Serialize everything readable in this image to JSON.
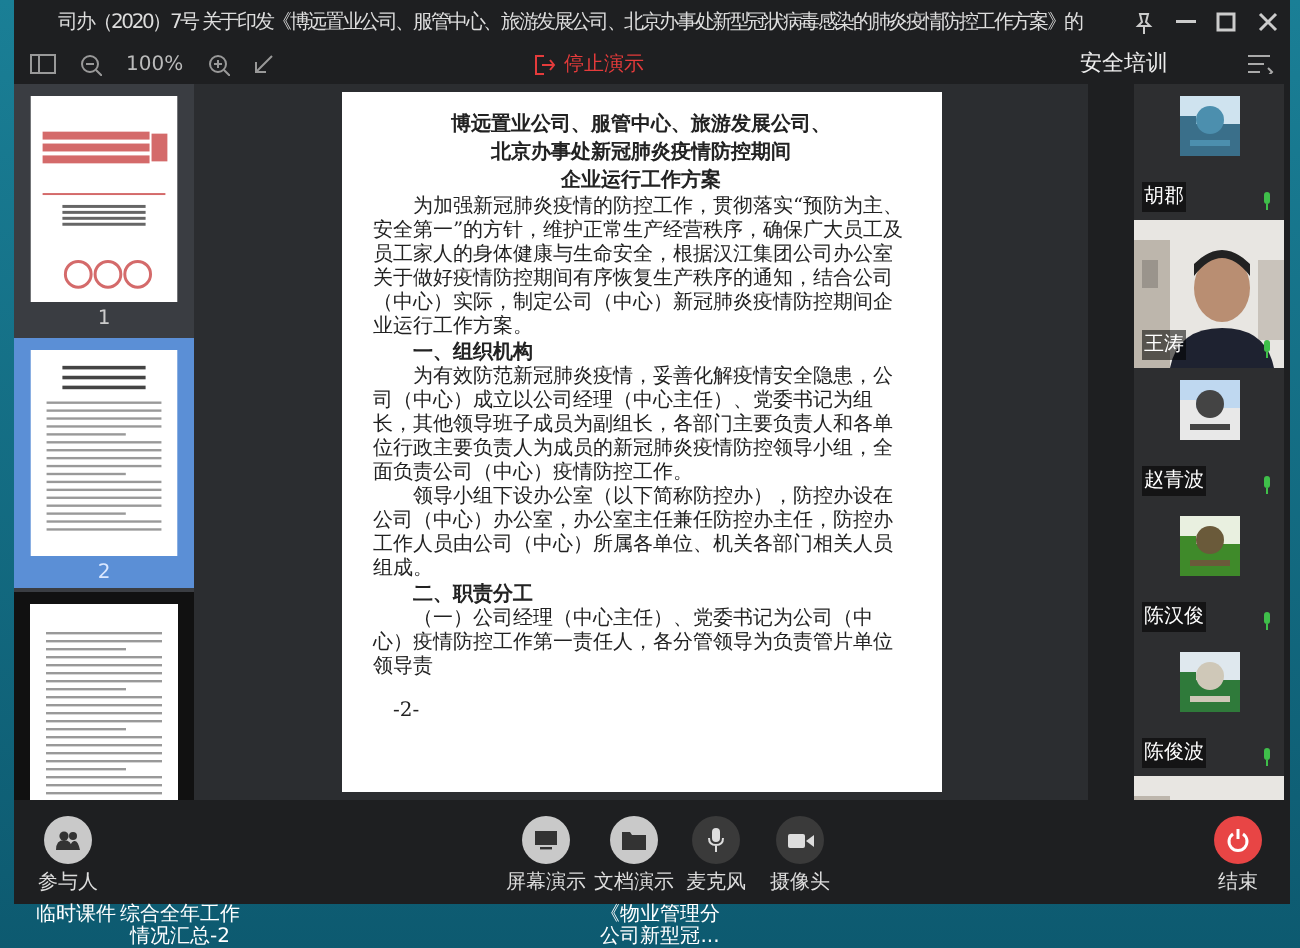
{
  "window": {
    "title": "司办（2020）7号 关于印发《博远置业公司、服管中心、旅游发展公司、北京办事处新型冠状病毒感染的肺炎疫情防控工作方案》的"
  },
  "toolbar": {
    "zoom": "100%",
    "stop_button": "停止演示",
    "meeting_name": "安全培训"
  },
  "thumbnails": [
    {
      "page": "1",
      "kind": "redhead",
      "selected": false
    },
    {
      "page": "2",
      "kind": "text",
      "selected": true
    },
    {
      "kind": "text",
      "selected": false
    }
  ],
  "document": {
    "titles": [
      "博远置业公司、服管中心、旅游发展公司、",
      "北京办事处新冠肺炎疫情防控期间",
      "企业运行工作方案"
    ],
    "blocks": [
      {
        "kind": "paragraph",
        "text": "为加强新冠肺炎疫情的防控工作，贯彻落实“预防为主、安全第一”的方针，维护正常生产经营秩序，确保广大员工及员工家人的身体健康与生命安全，根据汉江集团公司办公室关于做好疫情防控期间有序恢复生产秩序的通知，结合公司（中心）实际，制定公司（中心）新冠肺炎疫情防控期间企业运行工作方案。"
      },
      {
        "kind": "heading",
        "text": "一、组织机构"
      },
      {
        "kind": "paragraph",
        "text": "为有效防范新冠肺炎疫情，妥善化解疫情安全隐患，公司（中心）成立以公司经理（中心主任）、党委书记为组长，其他领导班子成员为副组长，各部门主要负责人和各单位行政主要负责人为成员的新冠肺炎疫情防控领导小组，全面负责公司（中心）疫情防控工作。"
      },
      {
        "kind": "paragraph",
        "text": "领导小组下设办公室（以下简称防控办），防控办设在公司（中心）办公室，办公室主任兼任防控办主任，防控办工作人员由公司（中心）所属各单位、机关各部门相关人员组成。"
      },
      {
        "kind": "heading",
        "text": "二、职责分工"
      },
      {
        "kind": "paragraph",
        "text": "（一）公司经理（中心主任）、党委书记为公司（中心）疫情防控工作第一责任人，各分管领导为负责管片单位领导责"
      }
    ],
    "page_number": "-2-"
  },
  "participants": [
    {
      "name": "胡郡",
      "kind": "avatar"
    },
    {
      "name": "王涛",
      "kind": "video"
    },
    {
      "name": "赵青波",
      "kind": "avatar"
    },
    {
      "name": "陈汉俊",
      "kind": "avatar"
    },
    {
      "name": "陈俊波",
      "kind": "avatar"
    },
    {
      "kind": "video"
    }
  ],
  "controls": [
    {
      "label": "参与人",
      "kind": "people"
    },
    {
      "label": "屏幕演示",
      "kind": "screen"
    },
    {
      "label": "文档演示",
      "kind": "folder"
    },
    {
      "label": "麦克风",
      "kind": "mic"
    },
    {
      "label": "摄像头",
      "kind": "camera"
    },
    {
      "label": "结束",
      "kind": "end"
    }
  ],
  "desktop_icons": [
    {
      "lines": [
        "临时课件"
      ]
    },
    {
      "lines": [
        "综合全年工作",
        "情况汇总-2"
      ]
    },
    {
      "lines": [
        "《物业管理分",
        "公司新型冠..."
      ]
    }
  ]
}
